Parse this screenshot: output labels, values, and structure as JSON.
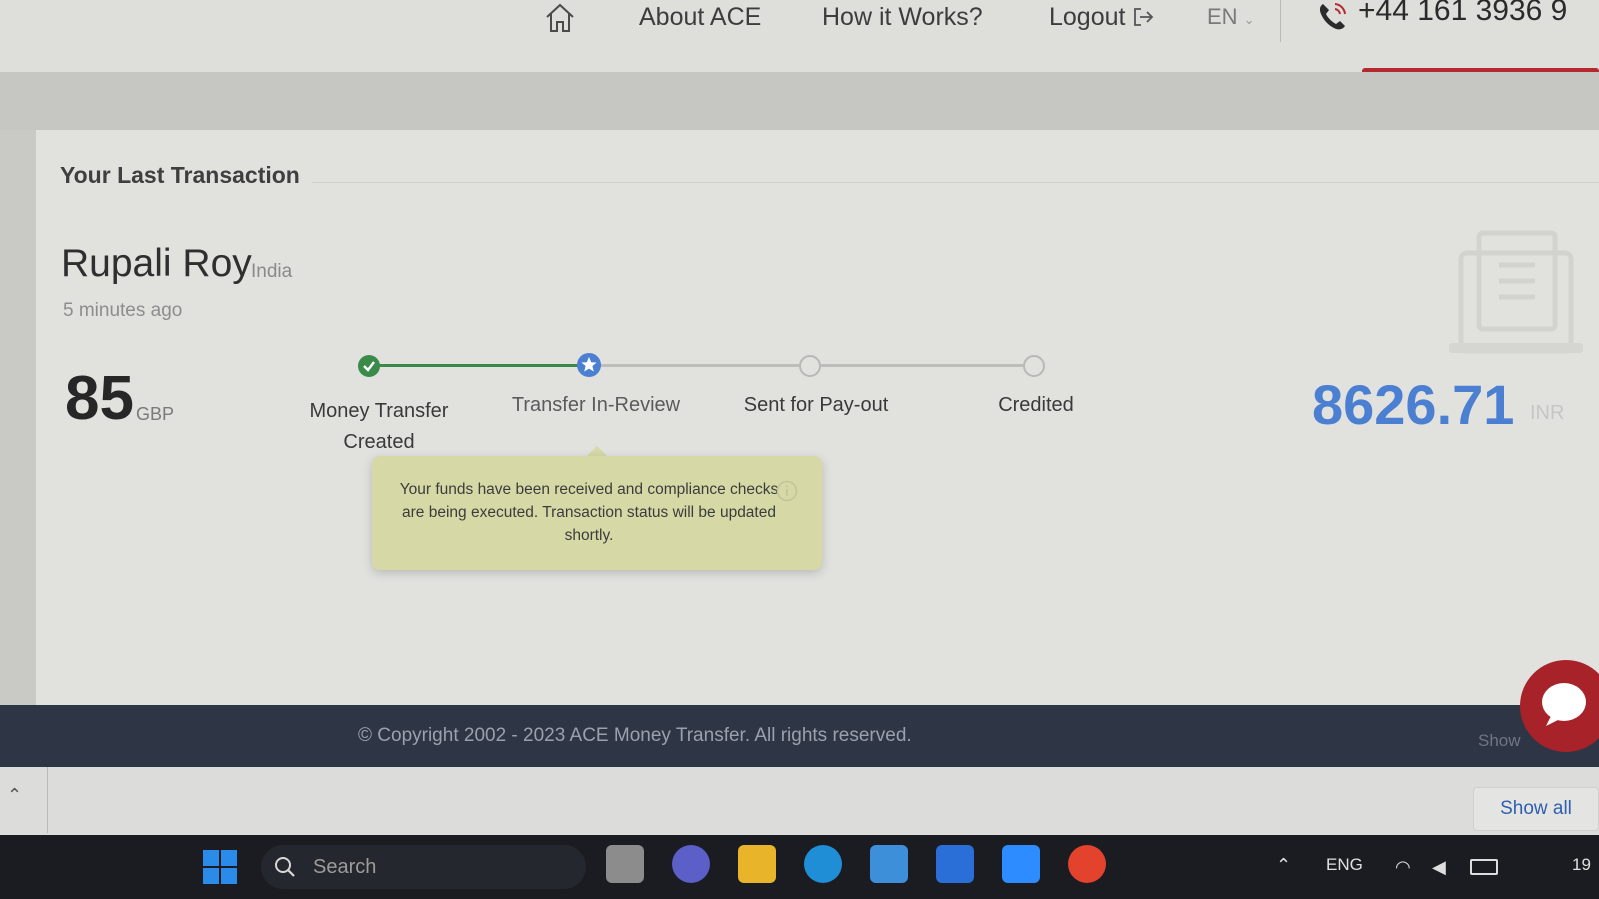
{
  "nav": {
    "about": "About ACE",
    "how": "How it Works?",
    "logout": "Logout",
    "lang": "EN",
    "phone": "+44 161 3936 9"
  },
  "transaction": {
    "title": "Your Last Transaction",
    "recipient": "Rupali Roy",
    "country": "India",
    "time": "5 minutes ago",
    "amount": "85",
    "amount_currency": "GBP",
    "payout": "8626.71",
    "payout_currency": "INR"
  },
  "steps": [
    {
      "label": "Money Transfer Created",
      "state": "done"
    },
    {
      "label": "Transfer In-Review",
      "state": "current"
    },
    {
      "label": "Sent for Pay-out",
      "state": "pending"
    },
    {
      "label": "Credited",
      "state": "pending"
    }
  ],
  "tooltip": {
    "text": "Your funds have been received and compliance checks are being executed. Transaction status will be updated shortly."
  },
  "footer": {
    "copyright": "© Copyright 2002 - 2023 ACE Money Transfer. All rights reserved.",
    "show_partial": "Show"
  },
  "downloads": {
    "show_all": "Show all"
  },
  "taskbar": {
    "search_label": "Search",
    "lang": "ENG",
    "clock": "19"
  },
  "colors": {
    "done": "#3a8a4a",
    "current": "#4a7fd1",
    "pending": "#b8b8b6",
    "accent": "#b5282e"
  }
}
